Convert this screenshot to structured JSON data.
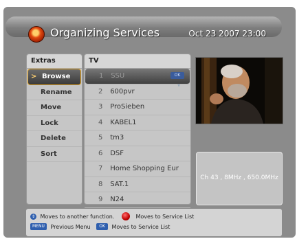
{
  "header": {
    "title": "Organizing Services",
    "datetime": "Oct 23 2007 23:00"
  },
  "extras": {
    "heading": "Extras",
    "items": [
      {
        "label": "Browse",
        "selected": true
      },
      {
        "label": "Rename"
      },
      {
        "label": "Move"
      },
      {
        "label": "Lock"
      },
      {
        "label": "Delete"
      },
      {
        "label": "Sort"
      }
    ]
  },
  "services": {
    "heading": "TV",
    "items": [
      {
        "num": "1",
        "name": "SSU",
        "selected": true
      },
      {
        "num": "2",
        "name": "600pvr"
      },
      {
        "num": "3",
        "name": "ProSieben"
      },
      {
        "num": "4",
        "name": "KABEL1"
      },
      {
        "num": "5",
        "name": "tm3"
      },
      {
        "num": "6",
        "name": "DSF"
      },
      {
        "num": "7",
        "name": "Home Shopping Eur"
      },
      {
        "num": "8",
        "name": "SAT.1"
      },
      {
        "num": "9",
        "name": "N24"
      }
    ],
    "ok_badge": "OK"
  },
  "channel_info": "Ch 43 , 8MHz , 650.0MHz",
  "help": {
    "line1_text": "Moves to another function.",
    "line1_text2": "Moves to Service List",
    "menu_key": "MENU",
    "line2_text": "Previous Menu",
    "ok_key": "OK",
    "line2_text2": "Moves to Service List"
  }
}
